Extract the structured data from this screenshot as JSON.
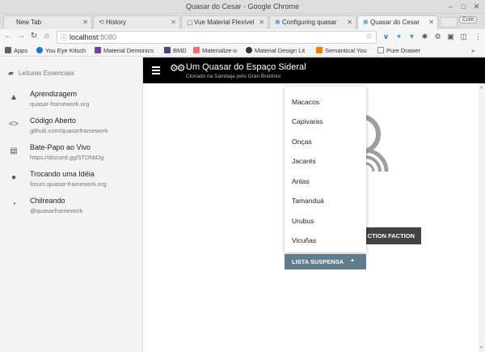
{
  "window": {
    "title": "Quasar do Cesar - Google Chrome"
  },
  "tabs": [
    {
      "label": "New Tab",
      "icon": "page-icon",
      "active": false
    },
    {
      "label": "History",
      "icon": "history-icon",
      "active": false
    },
    {
      "label": "Vue Material Flexível",
      "icon": "page-icon",
      "active": false
    },
    {
      "label": "Configuring quasar",
      "icon": "gear-icon",
      "active": false
    },
    {
      "label": "Quasar do Cesar",
      "icon": "gear-icon",
      "active": true
    }
  ],
  "profile": {
    "label": "Cole"
  },
  "toolbar": {
    "url_host": "localhost",
    "url_port": ":8080"
  },
  "bookmarks": [
    {
      "label": "Apps",
      "color": "#5f6368"
    },
    {
      "label": "You Eye Kitsch",
      "color": "#1976d2"
    },
    {
      "label": "Material Demonics",
      "color": "#7b3fa0"
    },
    {
      "label": "BMD",
      "color": "#563d7c"
    },
    {
      "label": "Materialize-o",
      "color": "#ee6e73"
    },
    {
      "label": "Material Design Lit",
      "color": "#333333"
    },
    {
      "label": "Semantical You",
      "color": "#f57c00"
    },
    {
      "label": "Pure Drawer",
      "color": "#888888"
    }
  ],
  "drawer": {
    "header": "Leituras Essenciais",
    "items": [
      {
        "label": "Aprendizagem",
        "sub": "quasar-framework.org",
        "icon": "school-icon"
      },
      {
        "label": "Código Aberto",
        "sub": "github.com/quasarframework",
        "icon": "code-icon"
      },
      {
        "label": "Bate-Papo ao Vivo",
        "sub": "https://discord.gg/5TDhbDg",
        "icon": "chat-icon"
      },
      {
        "label": "Trocando uma Idéia",
        "sub": "forum.quasar-framework.org",
        "icon": "forum-icon"
      },
      {
        "label": "Chilreando",
        "sub": "@quasarframework",
        "icon": "rss-icon"
      }
    ]
  },
  "appbar": {
    "title": "Um Quasar do Espaço Sideral",
    "subtitle": "Clonado na Sambaja pelo Gran Bretônio"
  },
  "main": {
    "faction_button": "CTION FACTION",
    "dropdown": {
      "options": [
        "Macacos",
        "Capivaras",
        "Onças",
        "Jacarés",
        "Antas",
        "Tamanduá",
        "Urubus",
        "Vicuñas"
      ],
      "button_label": "LISTA SUSPENSA"
    }
  },
  "colors": {
    "appbar": "#000000",
    "dropdown_button": "#607d8b",
    "faction_button": "#424242"
  }
}
